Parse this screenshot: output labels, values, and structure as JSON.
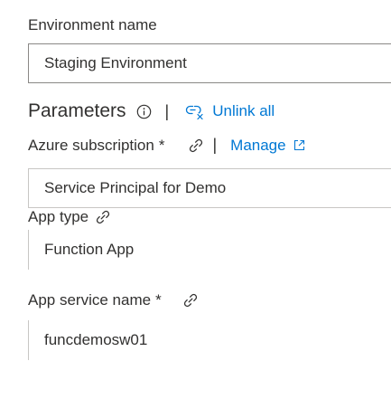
{
  "environment": {
    "label": "Environment name",
    "value": "Staging Environment"
  },
  "parameters": {
    "title": "Parameters",
    "separator": "|",
    "unlink_all": "Unlink all"
  },
  "azure_subscription": {
    "label": "Azure subscription",
    "required": "*",
    "separator": "|",
    "manage": "Manage",
    "value": "Service Principal for Demo"
  },
  "app_type": {
    "label": "App type",
    "value": "Function App"
  },
  "app_service_name": {
    "label": "App service name",
    "required": "*",
    "value": "funcdemosw01"
  },
  "colors": {
    "text": "#323130",
    "link": "#0078d4",
    "border": "#c8c6c4",
    "border_dark": "#8a8886"
  },
  "icons": {
    "info": "info-icon",
    "unlink": "unlink-icon",
    "link": "link-icon",
    "external": "external-link-icon"
  }
}
